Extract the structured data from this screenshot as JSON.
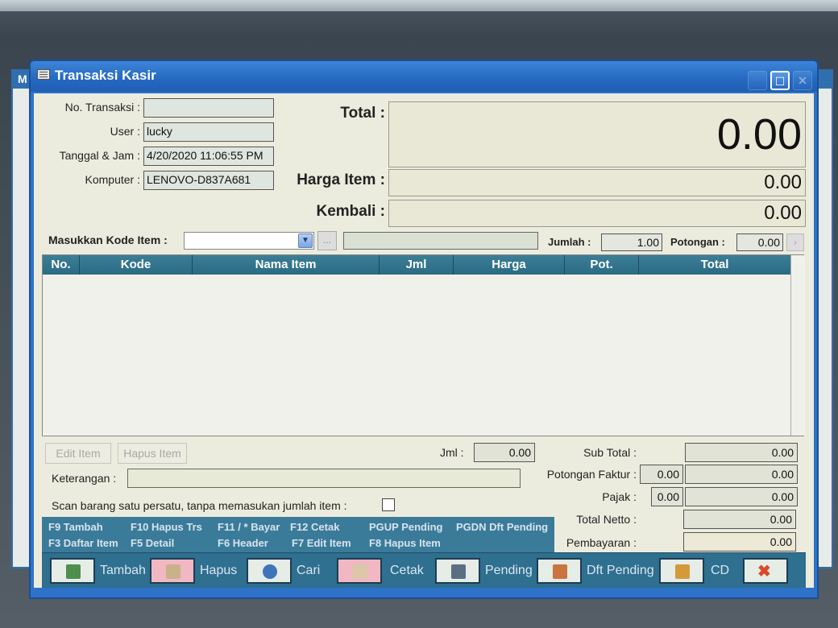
{
  "window": {
    "title": "Transaksi Kasir",
    "bg_title": "M"
  },
  "header": {
    "no_transaksi_label": "No. Transaksi :",
    "no_transaksi_value": "",
    "user_label": "User :",
    "user_value": "lucky",
    "tanggal_label": "Tanggal & Jam :",
    "tanggal_value": "4/20/2020 11:06:55 PM",
    "komputer_label": "Komputer :",
    "komputer_value": "LENOVO-D837A681",
    "total_label": "Total :",
    "total_value": "0.00",
    "harga_item_label": "Harga Item :",
    "harga_item_value": "0.00",
    "kembali_label": "Kembali :",
    "kembali_value": "0.00"
  },
  "entry": {
    "kode_label": "Masukkan Kode Item :",
    "jumlah_label": "Jumlah :",
    "jumlah_value": "1.00",
    "potongan_label": "Potongan :",
    "potongan_value": "0.00",
    "dots": "..."
  },
  "grid": {
    "columns": [
      "No.",
      "Kode",
      "Nama Item",
      "Jml",
      "Harga",
      "Pot.",
      "Total"
    ]
  },
  "footer": {
    "edit_item": "Edit Item",
    "hapus_item": "Hapus Item",
    "jml_label": "Jml :",
    "jml_value": "0.00",
    "keterangan_label": "Keterangan :",
    "scan_label": "Scan barang satu persatu, tanpa memasukan jumlah item :",
    "sub_total_label": "Sub Total :",
    "sub_total_value": "0.00",
    "potongan_faktur_label": "Potongan Faktur :",
    "potongan_faktur_pct": "0.00",
    "potongan_faktur_value": "0.00",
    "pajak_label": "Pajak :",
    "pajak_pct": "0.00",
    "pajak_value": "0.00",
    "total_netto_label": "Total Netto :",
    "total_netto_value": "0.00",
    "pembayaran_label": "Pembayaran :",
    "pembayaran_value": "0.00"
  },
  "shortcuts": {
    "f9": "F9 Tambah",
    "f10": "F10 Hapus Trs",
    "f11": "F11 / * Bayar",
    "f12": "F12 Cetak",
    "pgup": "PGUP Pending",
    "pgdn": "PGDN Dft Pending",
    "f3": "F3 Daftar Item",
    "f5": "F5 Detail",
    "f6": "F6 Header",
    "f7": "F7 Edit Item",
    "f8": "F8 Hapus Item"
  },
  "toolbar": {
    "tambah": "Tambah",
    "hapus": "Hapus",
    "cari": "Cari",
    "cetak": "Cetak",
    "pending": "Pending",
    "dft_pending": "Dft Pending",
    "cd": "CD",
    "close": "✖"
  },
  "colors": {
    "title_bar": "#2e73c8",
    "grid_header": "#3c7e96",
    "toolbar": "#2f6f90",
    "client_bg": "#ececde"
  }
}
